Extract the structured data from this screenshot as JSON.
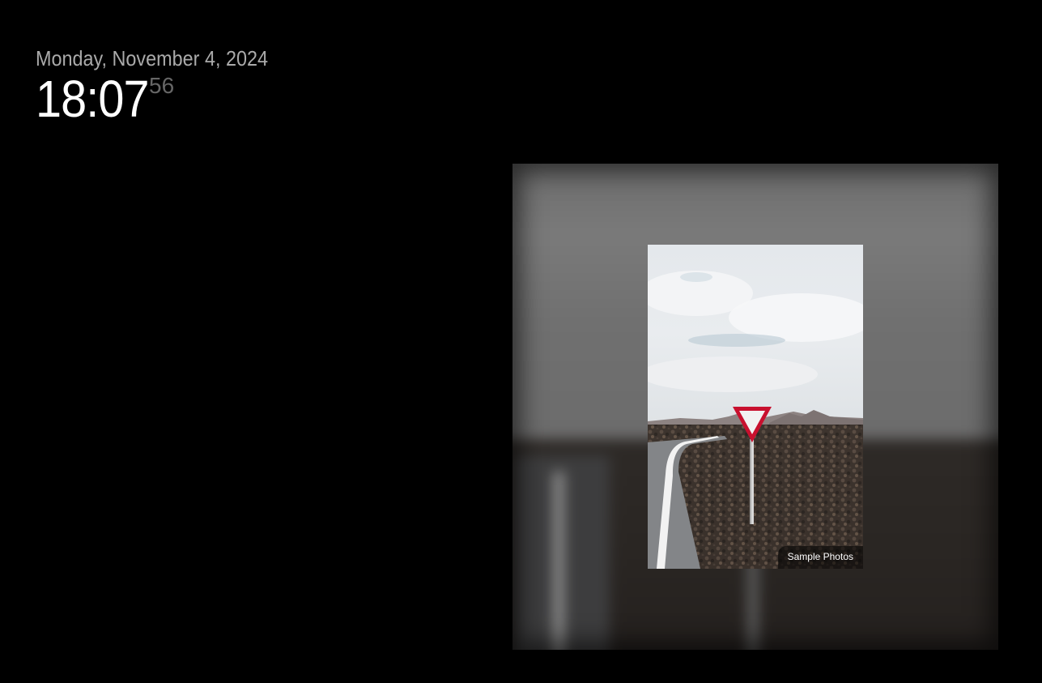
{
  "clock": {
    "date": "Monday, November 4, 2024",
    "time": "18:07",
    "seconds": "56"
  },
  "photo": {
    "caption": "Sample Photos",
    "subject": "yield-sign-road-photo"
  },
  "colors": {
    "background": "#000000",
    "date_text": "#aaaaaa",
    "time_text": "#ffffff",
    "seconds_text": "#666666",
    "sign_red": "#c8102e"
  }
}
